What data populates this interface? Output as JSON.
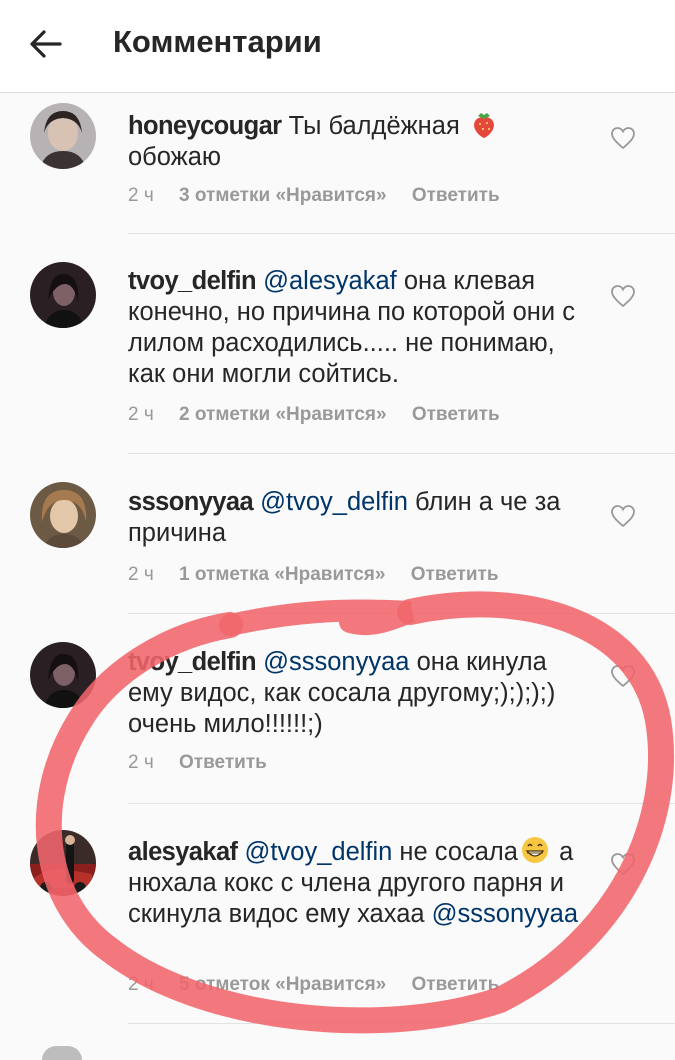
{
  "header": {
    "title": "Комментарии"
  },
  "comments": [
    {
      "username": "honeycougar",
      "text_a": "Ты балдёжная ",
      "text_b": "обожаю",
      "time": "2 ч",
      "likes": "3 отметки «Нравится»",
      "reply": "Ответить"
    },
    {
      "username": "tvoy_delfin",
      "mention": "@alesyakaf",
      "text_a": " она клевая конечно, но причина по которой они с лилом расходились..... не понимаю, как они могли сойтись.",
      "time": "2 ч",
      "likes": "2 отметки «Нравится»",
      "reply": "Ответить"
    },
    {
      "username": "sssonyyaa",
      "mention": "@tvoy_delfin",
      "text_a": " блин а че за причина",
      "time": "2 ч",
      "likes": "1 отметка «Нравится»",
      "reply": "Ответить"
    },
    {
      "username": "tvoy_delfin",
      "mention": "@sssonyyaa",
      "text_a": " она кинула ему видос, как сосала другому;);););) очень мило!!!!!!;)",
      "time": "2 ч",
      "reply": "Ответить"
    },
    {
      "username": "alesyakaf",
      "mention": "@tvoy_delfin",
      "text_a": " не сосала",
      "text_b": " а нюхала кокс с члена другого парня и скинула видос ему хахаа ",
      "mention2": "@sssonyyaa",
      "time": "2 ч",
      "likes": "5 отметок «Нравится»",
      "reply": "Ответить"
    }
  ],
  "icons": {
    "back": "arrow-left-icon",
    "like": "heart-outline-icon",
    "emoji_strawberry": "strawberry-emoji",
    "emoji_grin": "grinning-emoji"
  },
  "colors": {
    "mention": "#003569",
    "meta": "#999999",
    "annotation": "#f0656b"
  }
}
